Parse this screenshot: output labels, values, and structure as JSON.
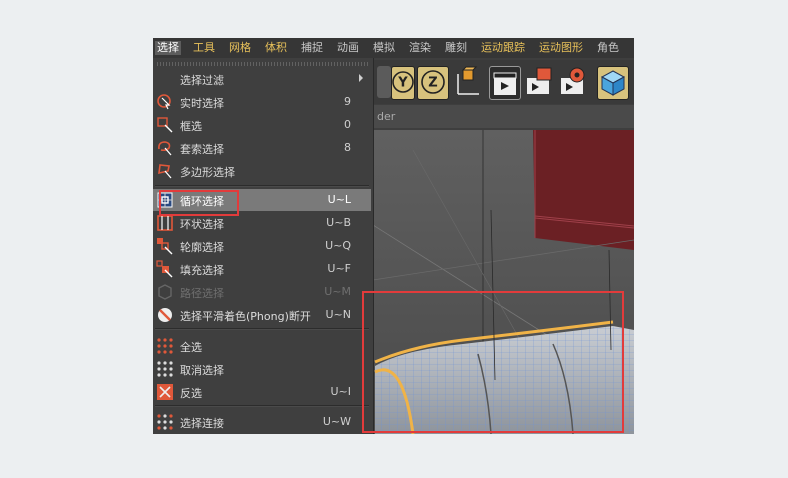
{
  "menubar": {
    "items": [
      "选择",
      "工具",
      "网格",
      "体积",
      "捕捉",
      "动画",
      "模拟",
      "渲染",
      "雕刻",
      "运动跟踪",
      "运动图形",
      "角色"
    ]
  },
  "viewport": {
    "label": "der"
  },
  "toolbar": {
    "y_label": "Y",
    "z_label": "Z"
  },
  "menu": {
    "items": [
      {
        "label": "选择过滤",
        "shortcut": "",
        "icon": "none"
      },
      {
        "label": "实时选择",
        "shortcut": "9",
        "icon": "live-selection-icon"
      },
      {
        "label": "框选",
        "shortcut": "0",
        "icon": "rectangle-selection-icon"
      },
      {
        "label": "套索选择",
        "shortcut": "8",
        "icon": "lasso-selection-icon"
      },
      {
        "label": "多边形选择",
        "shortcut": "",
        "icon": "polygon-selection-icon"
      },
      {
        "label": "循环选择",
        "shortcut": "U~L",
        "icon": "loop-selection-icon"
      },
      {
        "label": "环状选择",
        "shortcut": "U~B",
        "icon": "ring-selection-icon"
      },
      {
        "label": "轮廓选择",
        "shortcut": "U~Q",
        "icon": "outline-selection-icon"
      },
      {
        "label": "填充选择",
        "shortcut": "U~F",
        "icon": "fill-selection-icon"
      },
      {
        "label": "路径选择",
        "shortcut": "U~M",
        "icon": "path-selection-icon"
      },
      {
        "label": "选择平滑着色(Phong)断开",
        "shortcut": "U~N",
        "icon": "phong-break-icon"
      },
      {
        "label": "全选",
        "shortcut": "",
        "icon": "select-all-icon"
      },
      {
        "label": "取消选择",
        "shortcut": "",
        "icon": "deselect-icon"
      },
      {
        "label": "反选",
        "shortcut": "U~I",
        "icon": "invert-selection-icon"
      },
      {
        "label": "选择连接",
        "shortcut": "U~W",
        "icon": "select-connected-icon"
      }
    ]
  },
  "colors": {
    "accent_yellow": "#e8c15a",
    "highlight_box": "#e23b3b",
    "selected_row": "#7a7a7a"
  }
}
